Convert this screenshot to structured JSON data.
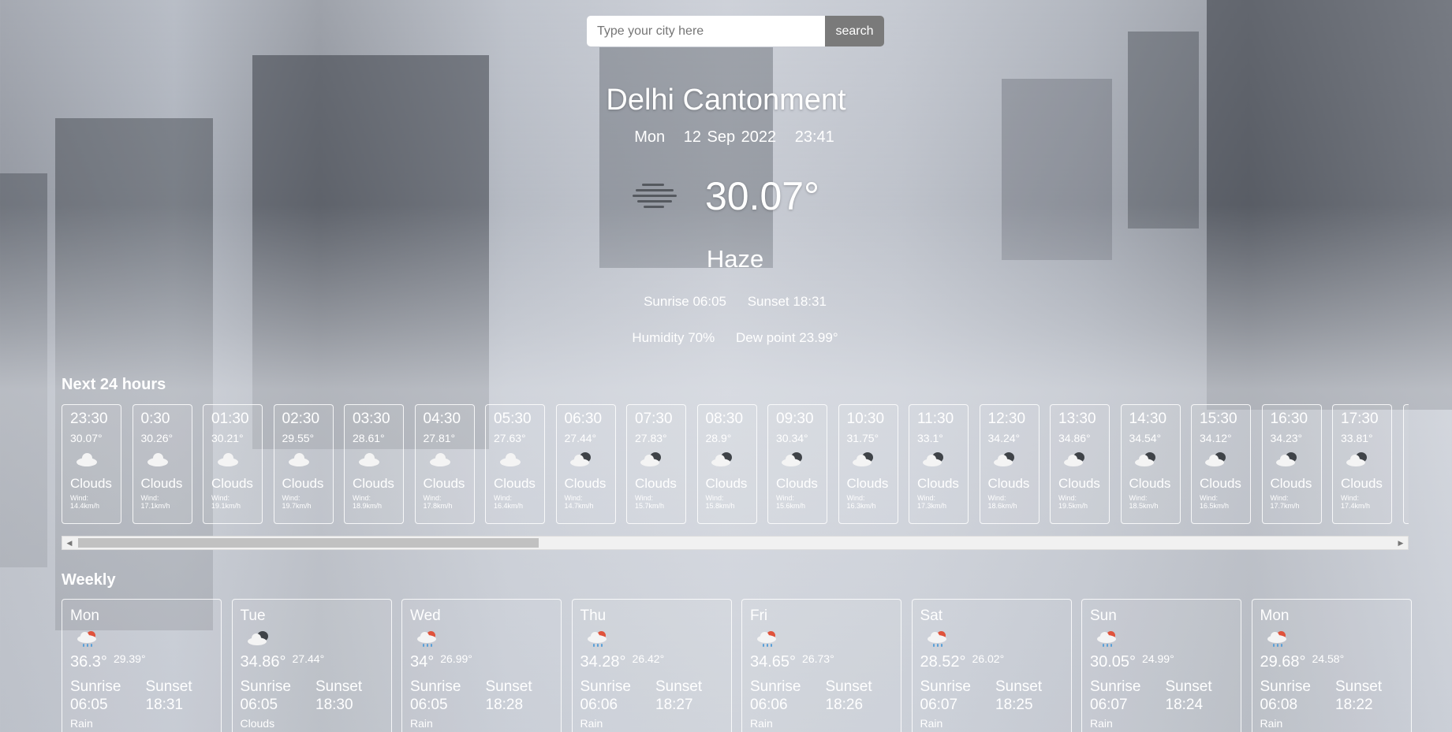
{
  "search": {
    "placeholder": "Type your city here",
    "button_label": "search"
  },
  "current": {
    "city": "Delhi Cantonment",
    "day": "Mon",
    "date": "12 Sep 2022",
    "time": "23:41",
    "icon": "haze-icon",
    "temperature": "30.07°",
    "condition": "Haze",
    "sunrise": "Sunrise 06:05",
    "sunset": "Sunset 18:31",
    "humidity": "Humidity 70%",
    "dew_point": "Dew point 23.99°"
  },
  "hourly": {
    "title": "Next 24 hours",
    "items": [
      {
        "time": "23:30",
        "temp": "30.07°",
        "icon": "cloud-icon",
        "desc": "Clouds",
        "wind_label": "Wind:",
        "wind": "14.4km/h"
      },
      {
        "time": "0:30",
        "temp": "30.26°",
        "icon": "cloud-icon",
        "desc": "Clouds",
        "wind_label": "Wind:",
        "wind": "17.1km/h"
      },
      {
        "time": "01:30",
        "temp": "30.21°",
        "icon": "cloud-icon",
        "desc": "Clouds",
        "wind_label": "Wind:",
        "wind": "19.1km/h"
      },
      {
        "time": "02:30",
        "temp": "29.55°",
        "icon": "cloud-icon",
        "desc": "Clouds",
        "wind_label": "Wind:",
        "wind": "19.7km/h"
      },
      {
        "time": "03:30",
        "temp": "28.61°",
        "icon": "cloud-icon",
        "desc": "Clouds",
        "wind_label": "Wind:",
        "wind": "18.9km/h"
      },
      {
        "time": "04:30",
        "temp": "27.81°",
        "icon": "cloud-icon",
        "desc": "Clouds",
        "wind_label": "Wind:",
        "wind": "17.8km/h"
      },
      {
        "time": "05:30",
        "temp": "27.63°",
        "icon": "cloud-icon",
        "desc": "Clouds",
        "wind_label": "Wind:",
        "wind": "16.4km/h"
      },
      {
        "time": "06:30",
        "temp": "27.44°",
        "icon": "broken-cloud-icon",
        "desc": "Clouds",
        "wind_label": "Wind:",
        "wind": "14.7km/h"
      },
      {
        "time": "07:30",
        "temp": "27.83°",
        "icon": "broken-cloud-icon",
        "desc": "Clouds",
        "wind_label": "Wind:",
        "wind": "15.7km/h"
      },
      {
        "time": "08:30",
        "temp": "28.9°",
        "icon": "broken-cloud-icon",
        "desc": "Clouds",
        "wind_label": "Wind:",
        "wind": "15.8km/h"
      },
      {
        "time": "09:30",
        "temp": "30.34°",
        "icon": "broken-cloud-icon",
        "desc": "Clouds",
        "wind_label": "Wind:",
        "wind": "15.6km/h"
      },
      {
        "time": "10:30",
        "temp": "31.75°",
        "icon": "broken-cloud-icon",
        "desc": "Clouds",
        "wind_label": "Wind:",
        "wind": "16.3km/h"
      },
      {
        "time": "11:30",
        "temp": "33.1°",
        "icon": "broken-cloud-icon",
        "desc": "Clouds",
        "wind_label": "Wind:",
        "wind": "17.3km/h"
      },
      {
        "time": "12:30",
        "temp": "34.24°",
        "icon": "broken-cloud-icon",
        "desc": "Clouds",
        "wind_label": "Wind:",
        "wind": "18.6km/h"
      },
      {
        "time": "13:30",
        "temp": "34.86°",
        "icon": "broken-cloud-icon",
        "desc": "Clouds",
        "wind_label": "Wind:",
        "wind": "19.5km/h"
      },
      {
        "time": "14:30",
        "temp": "34.54°",
        "icon": "broken-cloud-icon",
        "desc": "Clouds",
        "wind_label": "Wind:",
        "wind": "18.5km/h"
      },
      {
        "time": "15:30",
        "temp": "34.12°",
        "icon": "broken-cloud-icon",
        "desc": "Clouds",
        "wind_label": "Wind:",
        "wind": "16.5km/h"
      },
      {
        "time": "16:30",
        "temp": "34.23°",
        "icon": "broken-cloud-icon",
        "desc": "Clouds",
        "wind_label": "Wind:",
        "wind": "17.7km/h"
      },
      {
        "time": "17:30",
        "temp": "33.81°",
        "icon": "broken-cloud-icon",
        "desc": "Clouds",
        "wind_label": "Wind:",
        "wind": "17.4km/h"
      }
    ]
  },
  "weekly": {
    "title": "Weekly",
    "sunrise_label": "Sunrise",
    "sunset_label": "Sunset",
    "items": [
      {
        "day": "Mon",
        "icon": "rain-icon",
        "max": "36.3°",
        "min": "29.39°",
        "sunrise": "06:05",
        "sunset": "18:31",
        "extra": "Rain"
      },
      {
        "day": "Tue",
        "icon": "broken-cloud-icon",
        "max": "34.86°",
        "min": "27.44°",
        "sunrise": "06:05",
        "sunset": "18:30",
        "extra": "Clouds"
      },
      {
        "day": "Wed",
        "icon": "rain-icon",
        "max": "34°",
        "min": "26.99°",
        "sunrise": "06:05",
        "sunset": "18:28",
        "extra": "Rain"
      },
      {
        "day": "Thu",
        "icon": "rain-icon",
        "max": "34.28°",
        "min": "26.42°",
        "sunrise": "06:06",
        "sunset": "18:27",
        "extra": "Rain"
      },
      {
        "day": "Fri",
        "icon": "rain-icon",
        "max": "34.65°",
        "min": "26.73°",
        "sunrise": "06:06",
        "sunset": "18:26",
        "extra": "Rain"
      },
      {
        "day": "Sat",
        "icon": "rain-icon",
        "max": "28.52°",
        "min": "26.02°",
        "sunrise": "06:07",
        "sunset": "18:25",
        "extra": "Rain"
      },
      {
        "day": "Sun",
        "icon": "rain-icon",
        "max": "30.05°",
        "min": "24.99°",
        "sunrise": "06:07",
        "sunset": "18:24",
        "extra": "Rain"
      },
      {
        "day": "Mon",
        "icon": "rain-icon",
        "max": "29.68°",
        "min": "24.58°",
        "sunrise": "06:08",
        "sunset": "18:22",
        "extra": "Rain"
      }
    ]
  },
  "scrollbar": {
    "thumb_fraction": 0.35,
    "position_fraction": 0.0
  },
  "colors": {
    "search_button": "#7a7a7a",
    "card_border": "#ffffff",
    "rain_drop": "#5aa0d8",
    "sun_accent": "#e0523b"
  }
}
